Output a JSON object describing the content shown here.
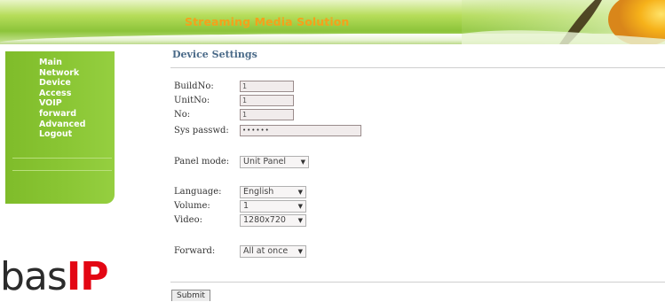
{
  "banner": {
    "title": "Streaming Media Solution"
  },
  "sidebar": {
    "items": [
      {
        "label": "Main"
      },
      {
        "label": "Network"
      },
      {
        "label": "Device"
      },
      {
        "label": "Access"
      },
      {
        "label": "VOIP"
      },
      {
        "label": "forward"
      },
      {
        "label": "Advanced"
      },
      {
        "label": "Logout"
      }
    ]
  },
  "logo": {
    "part1": "bas",
    "part2": "IP"
  },
  "main": {
    "title": "Device Settings",
    "build_no": {
      "label": "BuildNo:",
      "value": "1"
    },
    "unit_no": {
      "label": "UnitNo:",
      "value": "1"
    },
    "no": {
      "label": "No:",
      "value": "1"
    },
    "sys_passwd": {
      "label": "Sys passwd:",
      "value": "••••••"
    },
    "panel_mode": {
      "label": "Panel mode:",
      "value": "Unit Panel"
    },
    "language": {
      "label": "Language:",
      "value": "English"
    },
    "volume": {
      "label": "Volume:",
      "value": "1"
    },
    "video": {
      "label": "Video:",
      "value": "1280x720"
    },
    "forward": {
      "label": "Forward:",
      "value": "All at once"
    },
    "submit_label": "Submit"
  },
  "icons": {
    "select_arrow": "chevron-down-icon"
  },
  "colors": {
    "banner_green": "#8cc43a",
    "sidebar_green": "#8ac634",
    "banner_title": "#f4a11c",
    "logo_red": "#e30613",
    "heading_blue": "#4a6a88"
  }
}
